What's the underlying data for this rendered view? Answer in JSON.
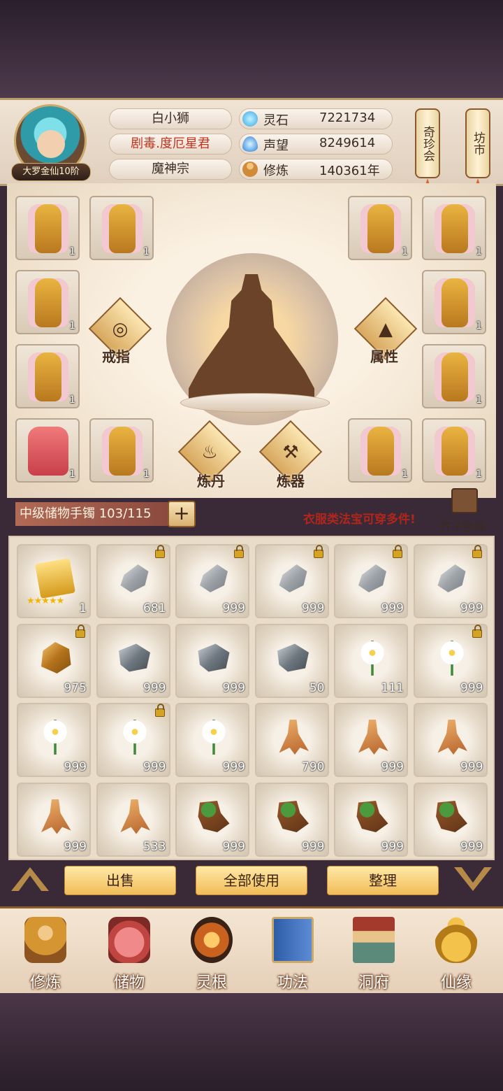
{
  "player": {
    "name": "白小狮",
    "title": "剧毒.度厄星君",
    "sect": "魔神宗",
    "rank": "大罗金仙10阶"
  },
  "stats": [
    {
      "label": "灵石",
      "value": "7221734",
      "icon": "spirit-stone-icon"
    },
    {
      "label": "声望",
      "value": "8249614",
      "icon": "fame-flame-icon"
    },
    {
      "label": "修炼",
      "value": "140361年",
      "icon": "meditation-icon"
    }
  ],
  "side_buttons": {
    "treasure": "奇珍会",
    "market": "坊市"
  },
  "equipment": {
    "ring_label": "戒指",
    "attr_label": "属性",
    "alchemy_label": "炼丹",
    "forge_label": "炼器",
    "slots": [
      "1",
      "1",
      "1",
      "1",
      "1",
      "1",
      "1",
      "1",
      "1",
      "1",
      "1",
      "1"
    ]
  },
  "storage": {
    "bag_name": "中级储物手镯",
    "capacity": "103/115",
    "plus": "+",
    "hint": "衣服类法宝可穿多件!",
    "space_label": "芥子空间"
  },
  "items": [
    {
      "type": "scroll",
      "count": "1",
      "locked": false,
      "stars": "★★★★★"
    },
    {
      "type": "stone",
      "count": "681",
      "locked": true
    },
    {
      "type": "stone",
      "count": "999",
      "locked": true
    },
    {
      "type": "stone",
      "count": "999",
      "locked": true
    },
    {
      "type": "stone",
      "count": "999",
      "locked": true
    },
    {
      "type": "stone",
      "count": "999",
      "locked": true
    },
    {
      "type": "ore",
      "count": "975",
      "locked": true
    },
    {
      "type": "iron",
      "count": "999",
      "locked": false
    },
    {
      "type": "iron",
      "count": "999",
      "locked": false
    },
    {
      "type": "iron",
      "count": "50",
      "locked": false
    },
    {
      "type": "flower",
      "count": "111",
      "locked": false
    },
    {
      "type": "flower",
      "count": "999",
      "locked": true
    },
    {
      "type": "flower",
      "count": "999",
      "locked": false
    },
    {
      "type": "flower",
      "count": "999",
      "locked": true
    },
    {
      "type": "flower",
      "count": "999",
      "locked": false
    },
    {
      "type": "ginseng",
      "count": "790",
      "locked": false
    },
    {
      "type": "ginseng",
      "count": "999",
      "locked": false
    },
    {
      "type": "ginseng",
      "count": "999",
      "locked": false
    },
    {
      "type": "ginseng",
      "count": "999",
      "locked": false
    },
    {
      "type": "ginseng",
      "count": "533",
      "locked": false
    },
    {
      "type": "root",
      "count": "999",
      "locked": false
    },
    {
      "type": "root",
      "count": "999",
      "locked": false
    },
    {
      "type": "root",
      "count": "999",
      "locked": false
    },
    {
      "type": "root",
      "count": "999",
      "locked": false
    }
  ],
  "actions": {
    "sell": "出售",
    "use_all": "全部使用",
    "sort": "整理"
  },
  "nav": [
    {
      "label": "修炼",
      "icon": "monk-icon"
    },
    {
      "label": "储物",
      "icon": "pouch-icon"
    },
    {
      "label": "灵根",
      "icon": "spirit-root-icon"
    },
    {
      "label": "功法",
      "icon": "book-icon"
    },
    {
      "label": "洞府",
      "icon": "cave-palace-icon"
    },
    {
      "label": "仙缘",
      "icon": "gourd-icon"
    }
  ]
}
